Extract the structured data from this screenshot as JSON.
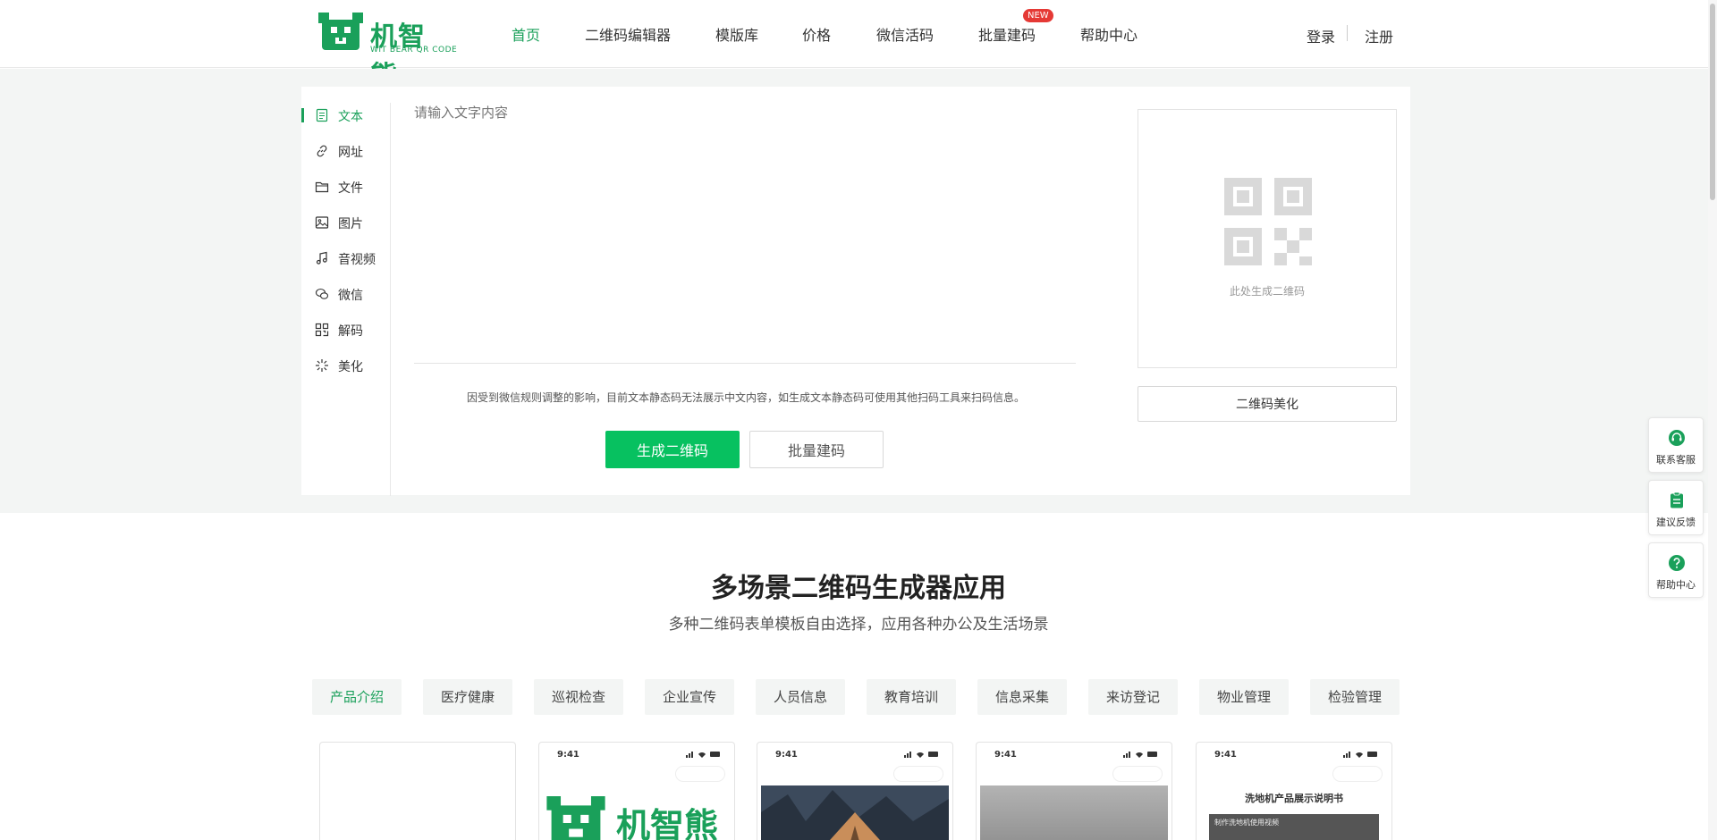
{
  "brand": {
    "name": "机智熊",
    "sub": "WIT BEAR QR CODE",
    "color": "#1aa05a"
  },
  "nav": {
    "items": [
      {
        "label": "首页",
        "active": true
      },
      {
        "label": "二维码编辑器"
      },
      {
        "label": "模版库"
      },
      {
        "label": "价格"
      },
      {
        "label": "微信活码"
      },
      {
        "label": "批量建码"
      },
      {
        "label": "帮助中心"
      }
    ],
    "new_badge": "NEW",
    "login": "登录",
    "register": "注册"
  },
  "sidebar": {
    "items": [
      {
        "label": "文本",
        "icon": "document-icon",
        "active": true
      },
      {
        "label": "网址",
        "icon": "link-icon"
      },
      {
        "label": "文件",
        "icon": "folder-icon"
      },
      {
        "label": "图片",
        "icon": "image-icon"
      },
      {
        "label": "音视频",
        "icon": "music-icon"
      },
      {
        "label": "微信",
        "icon": "wechat-icon"
      },
      {
        "label": "解码",
        "icon": "qr-scan-icon"
      },
      {
        "label": "美化",
        "icon": "sparkle-icon"
      }
    ]
  },
  "editor": {
    "placeholder": "请输入文字内容",
    "notice": "因受到微信规则调整的影响，目前文本静态码无法展示中文内容，如生成文本静态码可使用其他扫码工具来扫码信息。",
    "generate_label": "生成二维码",
    "batch_label": "批量建码"
  },
  "preview": {
    "placeholder": "此处生成二维码",
    "beautify_label": "二维码美化"
  },
  "float_buttons": [
    {
      "label": "联系客服",
      "icon": "headset-icon"
    },
    {
      "label": "建议反馈",
      "icon": "clipboard-icon"
    },
    {
      "label": "帮助中心",
      "icon": "help-icon"
    }
  ],
  "section": {
    "title": "多场景二维码生成器应用",
    "subtitle": "多种二维码表单模板自由选择，应用各种办公及生活场景",
    "tabs": [
      {
        "label": "产品介绍",
        "active": true
      },
      {
        "label": "医疗健康"
      },
      {
        "label": "巡视检查"
      },
      {
        "label": "企业宣传"
      },
      {
        "label": "人员信息"
      },
      {
        "label": "教育培训"
      },
      {
        "label": "信息采集"
      },
      {
        "label": "来访登记"
      },
      {
        "label": "物业管理"
      },
      {
        "label": "检验管理"
      }
    ]
  },
  "templates": [
    {
      "time": ""
    },
    {
      "time": "9:41",
      "logo_text": "机智熊"
    },
    {
      "time": "9:41"
    },
    {
      "time": "9:41"
    },
    {
      "time": "9:41",
      "title": "洗地机产品展示说明书",
      "caption": "制作洗地机使用视频"
    }
  ]
}
